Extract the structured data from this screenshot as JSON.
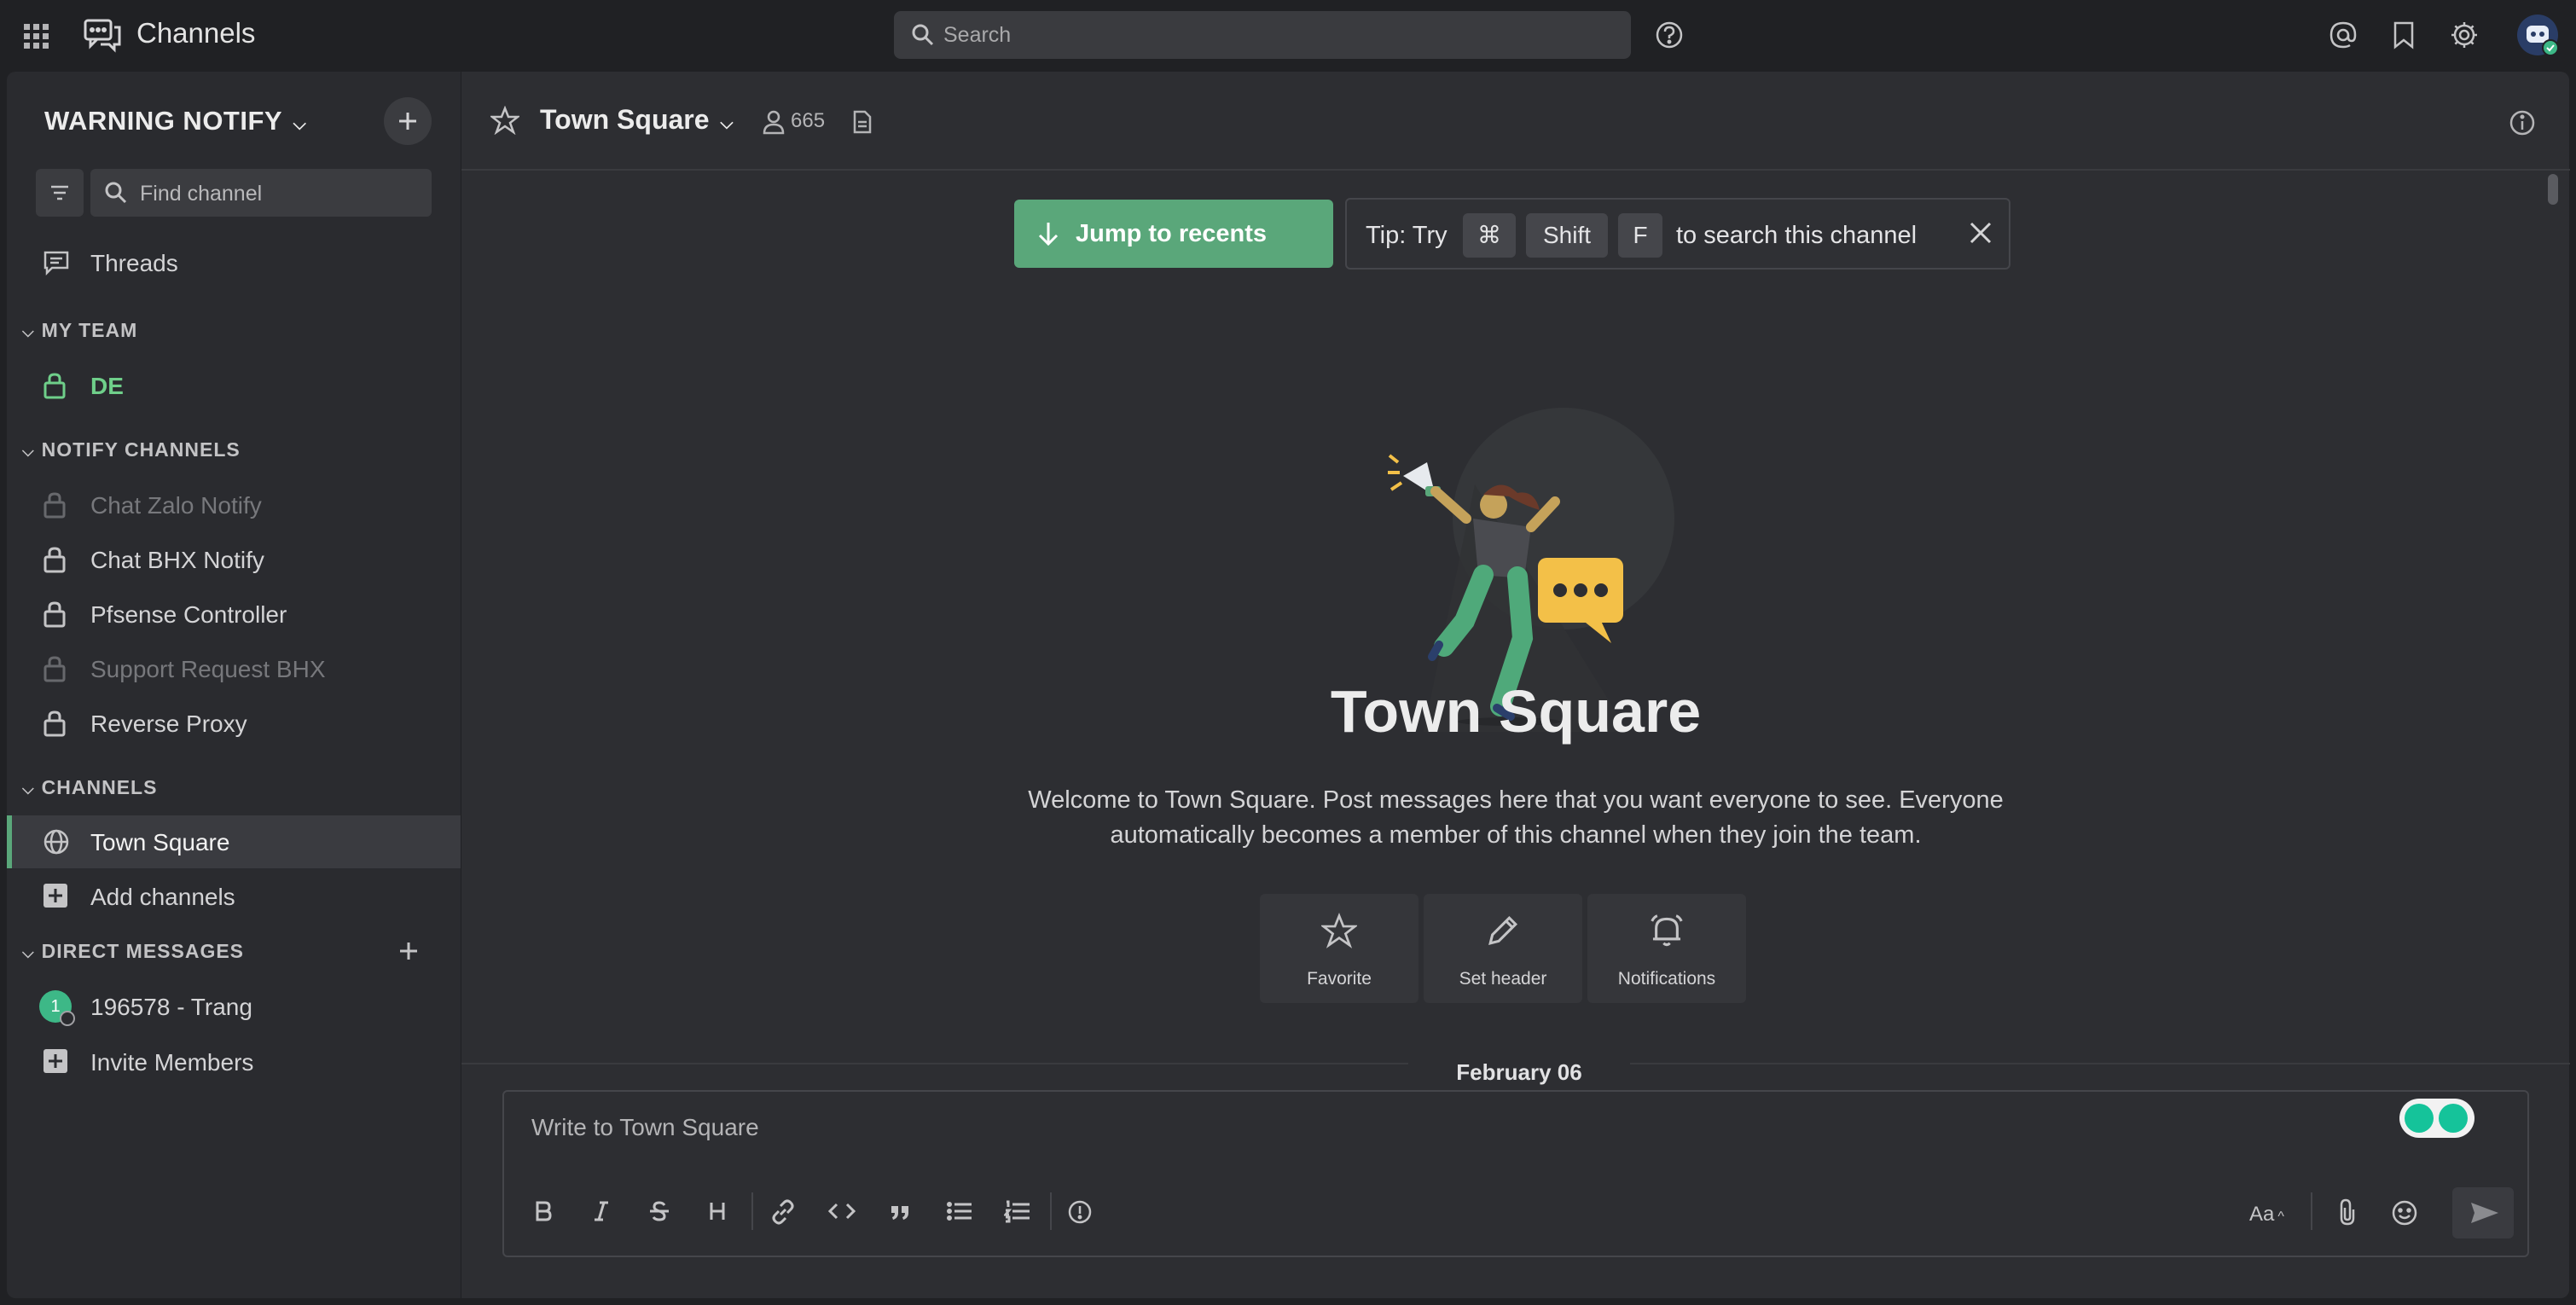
{
  "app": {
    "title": "Channels"
  },
  "search": {
    "placeholder": "Search"
  },
  "sidebar": {
    "team_name": "WARNING NOTIFY",
    "find_channel": "Find channel",
    "threads": "Threads",
    "sections": {
      "my_team": "MY TEAM",
      "notify_channels": "NOTIFY CHANNELS",
      "channels": "CHANNELS",
      "direct_messages": "DIRECT MESSAGES"
    },
    "my_team_items": [
      "DE"
    ],
    "notify_items": [
      {
        "label": "Chat Zalo Notify",
        "muted": true
      },
      {
        "label": "Chat BHX Notify",
        "muted": false
      },
      {
        "label": "Pfsense Controller",
        "muted": false
      },
      {
        "label": "Support Request BHX",
        "muted": true
      },
      {
        "label": "Reverse Proxy",
        "muted": false
      }
    ],
    "channel_items": [
      "Town Square",
      "Add channels"
    ],
    "dm_items": [
      "196578 - Trang",
      "Invite Members"
    ],
    "dm_avatar_initial": "1"
  },
  "header": {
    "channel_name": "Town Square",
    "member_count": "665"
  },
  "banner": {
    "jump_label": "Jump to recents",
    "tip_prefix": "Tip: Try",
    "key_cmd": "⌘",
    "key_shift": "Shift",
    "key_f": "F",
    "tip_suffix": "to search this channel"
  },
  "intro": {
    "title": "Town Square",
    "welcome": "Welcome to Town Square. Post messages here that you want everyone to see. Everyone automatically becomes a member of this channel when they join the team.",
    "actions": [
      "Favorite",
      "Set header",
      "Notifications"
    ]
  },
  "date_separator": "February 06",
  "composer": {
    "placeholder": "Write to Town Square",
    "font_toggle": "Aa"
  },
  "colors": {
    "accent": "#5aa77a",
    "sidebar_bg": "#2a2b2f",
    "main_bg": "#2d2e32",
    "topbar_bg": "#202124"
  }
}
